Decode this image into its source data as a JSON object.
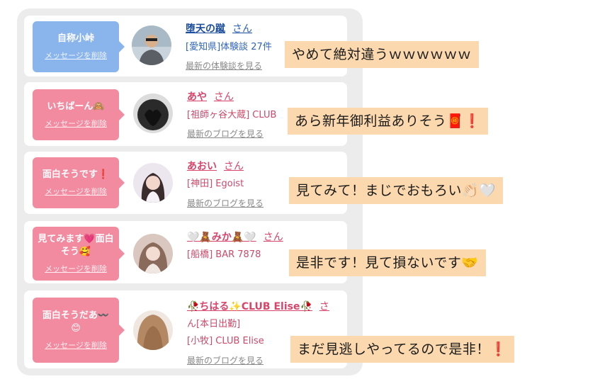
{
  "rows": [
    {
      "badge_text": "自称小峠",
      "delete_label": "メッセージを削除",
      "name": "堕天の蹴",
      "honorific": "さん",
      "info": "[愛知県]体験談 27件",
      "more_link": "最新の体験談を見る",
      "caption": "やめて絶対違うｗｗｗｗｗｗ"
    },
    {
      "badge_text": "いちばーん🙈",
      "delete_label": "メッセージを削除",
      "name": "あや",
      "honorific": "さん",
      "info": "[祖師ヶ谷大蔵] CLUB",
      "more_link": "最新のブログを見る",
      "caption": "あら新年御利益ありそう🧧❗️"
    },
    {
      "badge_text": "面白そうです❗️",
      "delete_label": "メッセージを削除",
      "name": "あおい",
      "honorific": "さん",
      "info": "[神田] Egoist",
      "more_link": "最新のブログを見る",
      "caption": "見てみて！まじでおもろい👏🏻🤍"
    },
    {
      "badge_text_line1": "見てみます💗面白",
      "badge_text_line2": "そう🥰",
      "delete_label": "メッセージを削除",
      "name": "🤍🧸みか🧸🤍",
      "honorific": "さん",
      "info": "[船橋] BAR 7878",
      "more_link": "",
      "caption": "是非です！見て損ないです🤝"
    },
    {
      "badge_text_line1": "面白そうだあ〰️",
      "badge_text_line2": "😊",
      "delete_label": "メッセージを削除",
      "name": "🥀ちはる✨CLUB Elise🥀",
      "honorific_line1": "さ",
      "honorific_line2": "ん",
      "sub": "[本日出勤]",
      "info": "[小牧] CLUB Elise",
      "more_link": "最新のブログを見る",
      "caption": "まだ見逃しやってるので是非！❗️"
    }
  ],
  "colors": {
    "blue_badge": "#8ab4ec",
    "pink_badge": "#f28aa0",
    "caption_bg": "#fbd8ad",
    "panel_bg": "#ececec"
  }
}
